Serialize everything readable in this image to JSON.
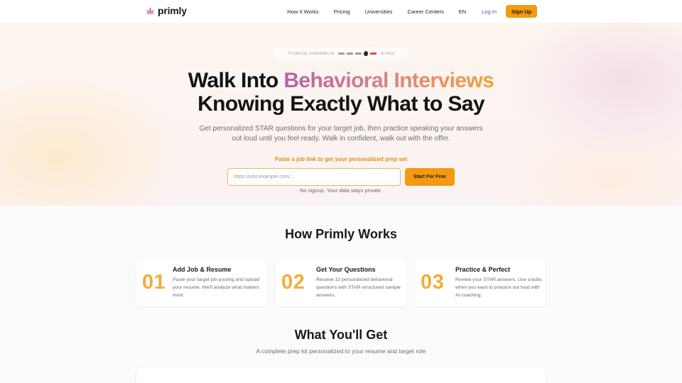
{
  "nav": {
    "logo_text": "primly",
    "links": [
      "How It Works",
      "Pricing",
      "Universities",
      "Career Centers"
    ],
    "lang": "EN",
    "login": "Log In",
    "signup": "Sign Up"
  },
  "hero": {
    "trusted_prefix": "Trusted by candidates at",
    "trusted_more": "& more",
    "headline_plain_1": "Walk Into ",
    "headline_gradient": "Behavioral Interviews",
    "headline_line_2": "Knowing Exactly What to Say",
    "subtitle": "Get personalized STAR questions for your target job, then practice speaking your answers out loud until you feel ready. Walk in confident, walk out with the offer.",
    "paste_label": "Paste a job link to get your personalized prep set",
    "input_placeholder": "https://jobs.example.com/...",
    "start_button": "Start For Free",
    "no_signup": "No signup. Your data stays private."
  },
  "how": {
    "title": "How Primly Works",
    "steps": [
      {
        "num": "01",
        "title": "Add Job & Resume",
        "desc": "Paste your target job posting and upload your resume. We'll analyze what matters most."
      },
      {
        "num": "02",
        "title": "Get Your Questions",
        "desc": "Receive 12 personalized behavioral questions with STAR-structured sample answers."
      },
      {
        "num": "03",
        "title": "Practice & Perfect",
        "desc": "Review your STAR answers. Use credits when you want to practice out loud with AI coaching."
      }
    ]
  },
  "get": {
    "title": "What You'll Get",
    "subtitle": "A complete prep kit personalized to your resume and target role"
  },
  "colors": {
    "accent_orange": "#f29a10",
    "accent_purple": "#7b3fa0",
    "gradient_pink": "#b463a6"
  }
}
